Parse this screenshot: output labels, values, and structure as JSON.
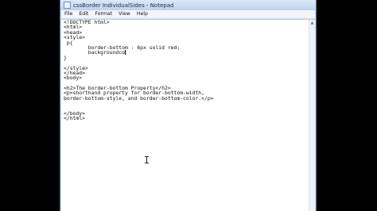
{
  "window": {
    "title": "cssBorder IndividualSides - Notepad"
  },
  "menu": {
    "items": [
      "File",
      "Edit",
      "Format",
      "View",
      "Help"
    ]
  },
  "editor": {
    "lines": [
      "<!DOCTYPE html>",
      "<html>",
      "<head>",
      "<style>",
      " p{",
      "        border-bottom : 6px solid red;",
      "        backgroundco",
      "}",
      "",
      "</style>",
      "</head>",
      "<body>",
      "",
      "<h2>The border-bottom Property</h2>",
      "<p>shorthand property for border-bottom-width,",
      "border-bottom-style, and border-bottom-color.</p>",
      "",
      "",
      "</body>",
      "</html>"
    ],
    "caret_line": 6
  }
}
